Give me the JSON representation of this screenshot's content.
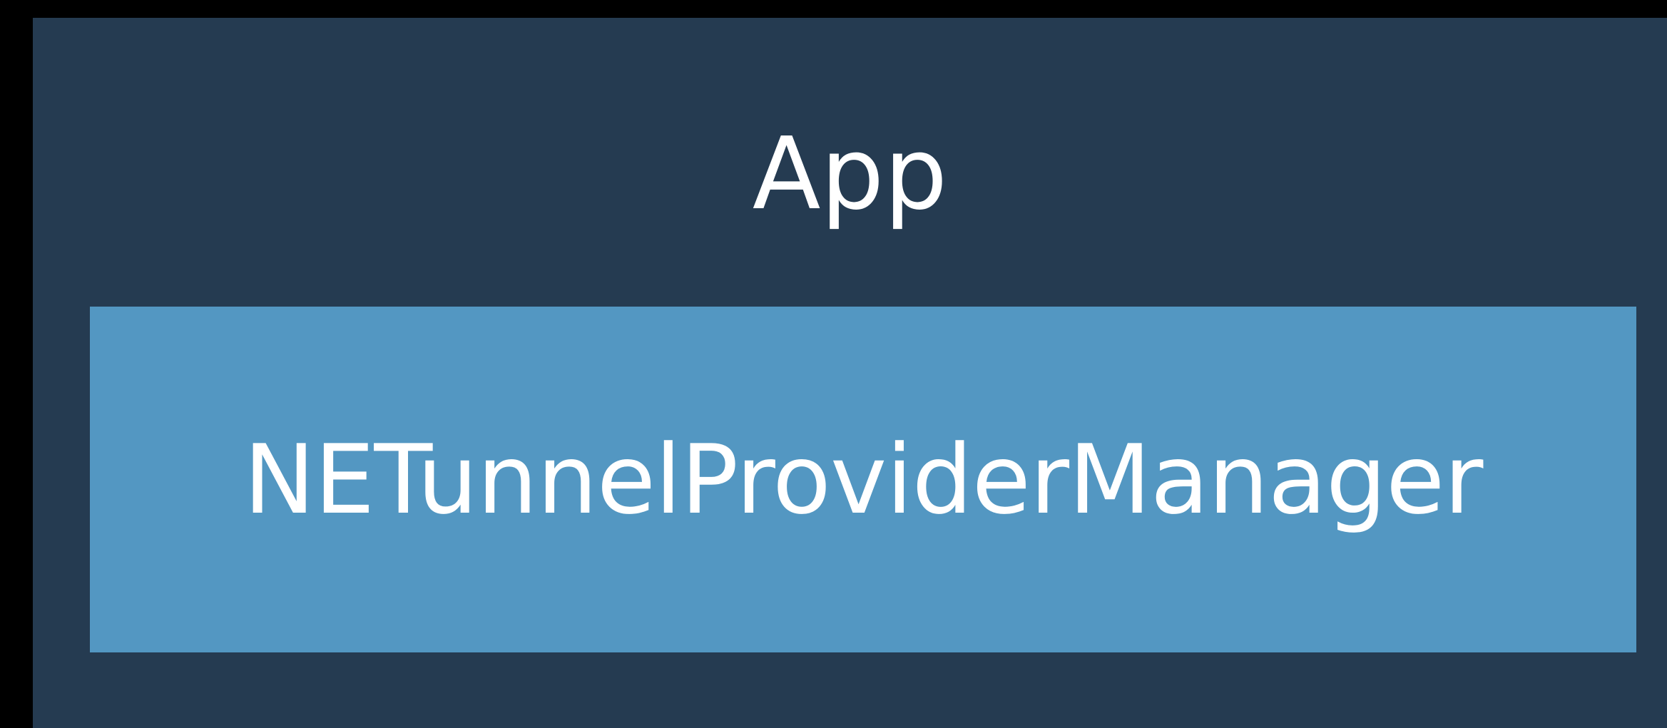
{
  "diagram": {
    "container": {
      "label": "App",
      "background": "#253b51"
    },
    "component": {
      "label": "NETunnelProviderManager",
      "background": "#5397c2"
    },
    "page_background": "#000000",
    "text_color": "#ffffff"
  }
}
